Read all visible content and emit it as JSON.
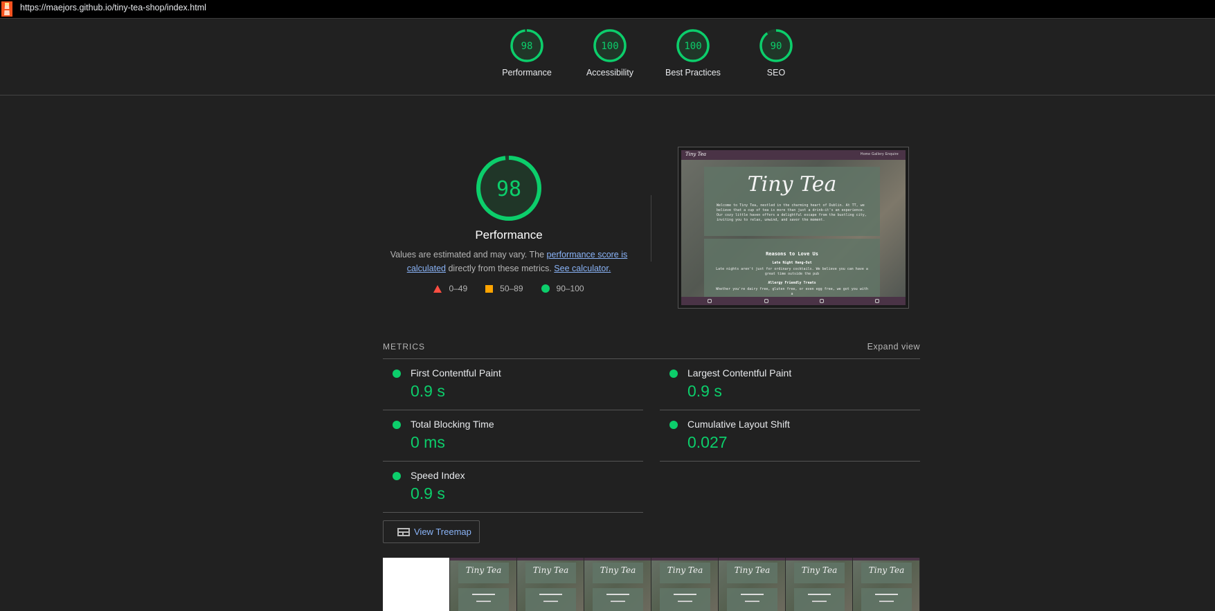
{
  "topbar": {
    "url": "https://maejors.github.io/tiny-tea-shop/index.html"
  },
  "summary_gauges": [
    {
      "score": "98",
      "label": "Performance",
      "value": 0.98
    },
    {
      "score": "100",
      "label": "Accessibility",
      "value": 1.0
    },
    {
      "score": "100",
      "label": "Best Practices",
      "value": 1.0
    },
    {
      "score": "90",
      "label": "SEO",
      "value": 0.9
    }
  ],
  "performance": {
    "score": "98",
    "value": 0.98,
    "title": "Performance",
    "desc_prefix": "Values are estimated and may vary. The ",
    "desc_link1": "performance score is calculated",
    "desc_middle": " directly from these metrics. ",
    "desc_link2": "See calculator."
  },
  "legend": {
    "fail": "0–49",
    "average": "50–89",
    "pass": "90–100"
  },
  "colors": {
    "pass": "#0cce6b",
    "average": "#ffa400",
    "fail": "#ff4e42",
    "link": "#8ab4f8"
  },
  "screenshot": {
    "brand": "Tiny Tea",
    "nav_links": "Home   Gallery   Enquire",
    "hero_title": "Tiny Tea",
    "hero_text": "Welcome to Tiny Tea, nestled in the charming heart of Dublin. At TT, we believe that a cup of tea is more than just a drink—it's an experience. Our cozy little haven offers a delightful escape from the bustling city, inviting you to relax, unwind, and savor the moment.",
    "section_title": "Reasons to Love Us",
    "sub1": "Late Night Hang-Out",
    "text1": "Late nights aren't just for ordinary cocktails. We believe you can have a great time outside the pub",
    "sub2": "Allergy Friendly Treats",
    "text2": "Whether you're dairy free, gluten free, or even egg free, we got you with a"
  },
  "metrics": {
    "header": "METRICS",
    "expand": "Expand view",
    "items": [
      {
        "name": "First Contentful Paint",
        "value": "0.9 s"
      },
      {
        "name": "Largest Contentful Paint",
        "value": "0.9 s"
      },
      {
        "name": "Total Blocking Time",
        "value": "0 ms"
      },
      {
        "name": "Cumulative Layout Shift",
        "value": "0.027"
      },
      {
        "name": "Speed Index",
        "value": "0.9 s"
      }
    ]
  },
  "treemap": {
    "label": "View Treemap"
  },
  "filmstrip": {
    "frame_title": "Tiny Tea"
  }
}
